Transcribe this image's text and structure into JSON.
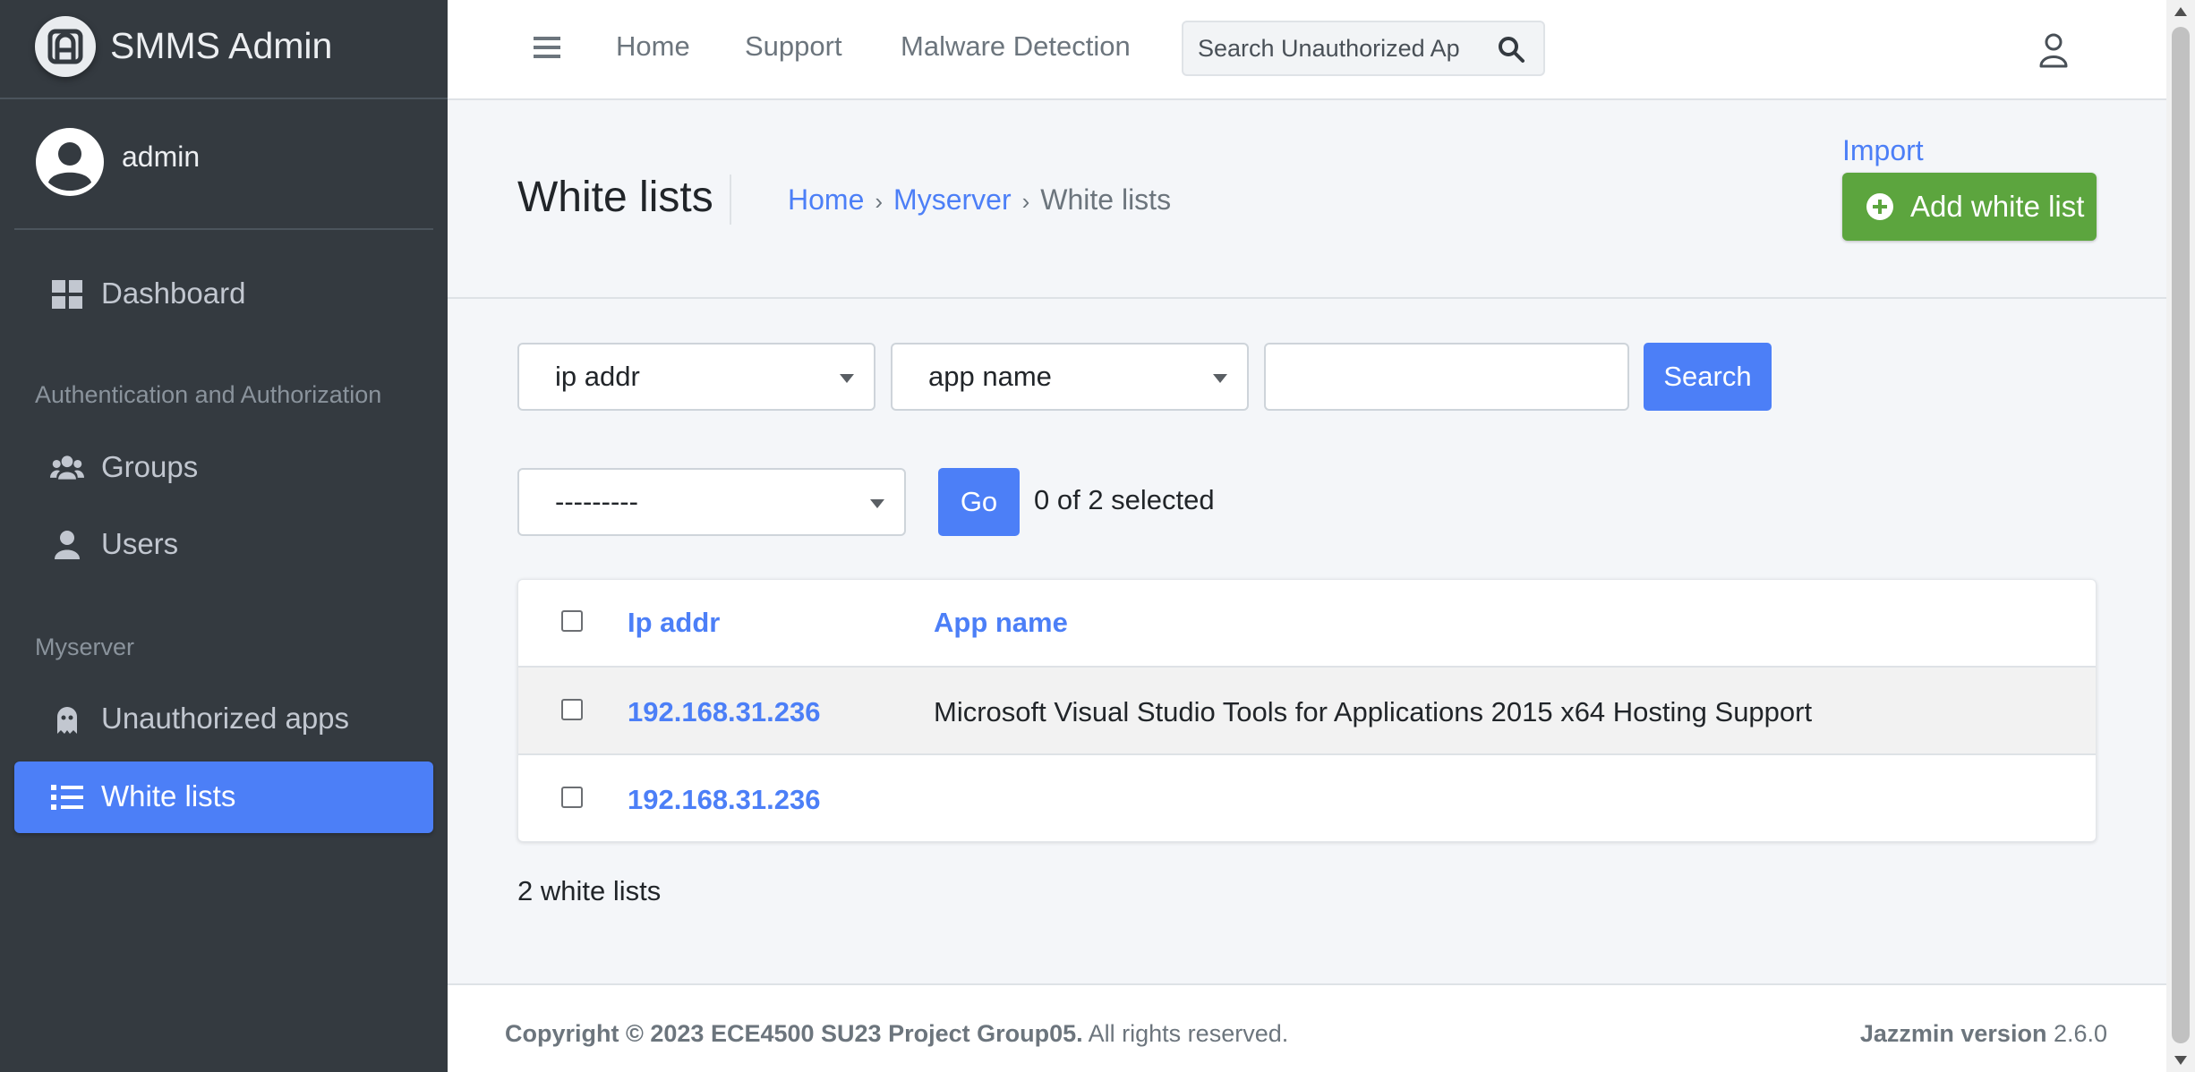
{
  "brand": {
    "name": "SMMS Admin",
    "logo_icon": "admin-logo-icon"
  },
  "user": {
    "name": "admin"
  },
  "sidebar": {
    "items": [
      {
        "label": "Dashboard",
        "icon": "dashboard-icon"
      },
      {
        "label": "Groups",
        "icon": "users-group-icon"
      },
      {
        "label": "Users",
        "icon": "user-icon"
      },
      {
        "label": "Unauthorized apps",
        "icon": "ghost-icon"
      },
      {
        "label": "White lists",
        "icon": "list-icon",
        "active": true
      }
    ],
    "sections": [
      "Authentication and Authorization",
      "Myserver"
    ]
  },
  "topbar": {
    "links": [
      "Home",
      "Support",
      "Malware Detection"
    ],
    "search_placeholder": "Search Unauthorized Ap"
  },
  "header": {
    "title": "White lists",
    "breadcrumb": [
      "Home",
      "Myserver",
      "White lists"
    ],
    "import_label": "Import",
    "add_label": "Add white list"
  },
  "filters": {
    "ip_select": "ip addr",
    "app_select": "app name",
    "search_value": "",
    "search_label": "Search",
    "action_select": "---------",
    "go_label": "Go",
    "selected_text": "0 of 2 selected"
  },
  "table": {
    "columns": [
      "Ip addr",
      "App name"
    ],
    "rows": [
      {
        "ip": "192.168.31.236",
        "app": "Microsoft Visual Studio Tools for Applications 2015 x64 Hosting Support"
      },
      {
        "ip": "192.168.31.236",
        "app": ""
      }
    ],
    "count_text": "2 white lists"
  },
  "footer": {
    "copyright_bold": "Copyright © 2023 ECE4500 SU23 Project Group05.",
    "copyright_rest": " All rights reserved.",
    "version_label": "Jazzmin version",
    "version_value": " 2.6.0"
  },
  "colors": {
    "sidebar_bg": "#343a40",
    "accent": "#4c7ff7",
    "success": "#5ca53e",
    "page_bg": "#f4f6f9"
  }
}
